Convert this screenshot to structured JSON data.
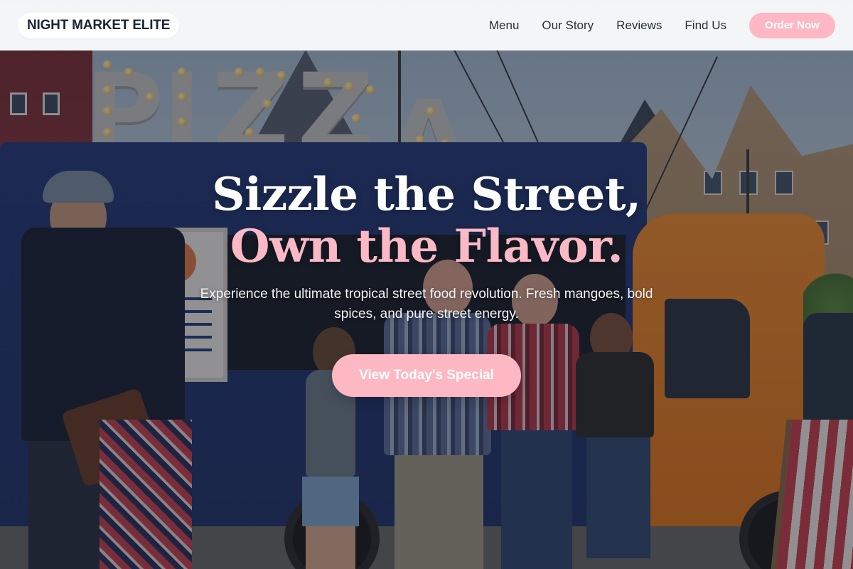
{
  "navbar": {
    "brand": "NIGHT MARKET ELITE",
    "links": [
      {
        "label": "Menu"
      },
      {
        "label": "Our Story"
      },
      {
        "label": "Reviews"
      },
      {
        "label": "Find Us"
      }
    ],
    "cta_label": "Order Now"
  },
  "hero": {
    "headline_line1": "Sizzle the Street,",
    "headline_line2": "Own the Flavor.",
    "subhead": "Experience the ultimate tropical street food revolution. Fresh mangoes, bold spices, and pure street energy.",
    "cta_label": "View Today's Special",
    "background_sign_text": "PIZZA"
  },
  "colors": {
    "accent_pink": "#fdb8c4",
    "headline_pink": "#fbb9c5",
    "nav_text": "#2a2f3a",
    "brand_text": "#1c2533",
    "truck_blue": "#263a78",
    "truck_orange": "#f08b2f"
  }
}
